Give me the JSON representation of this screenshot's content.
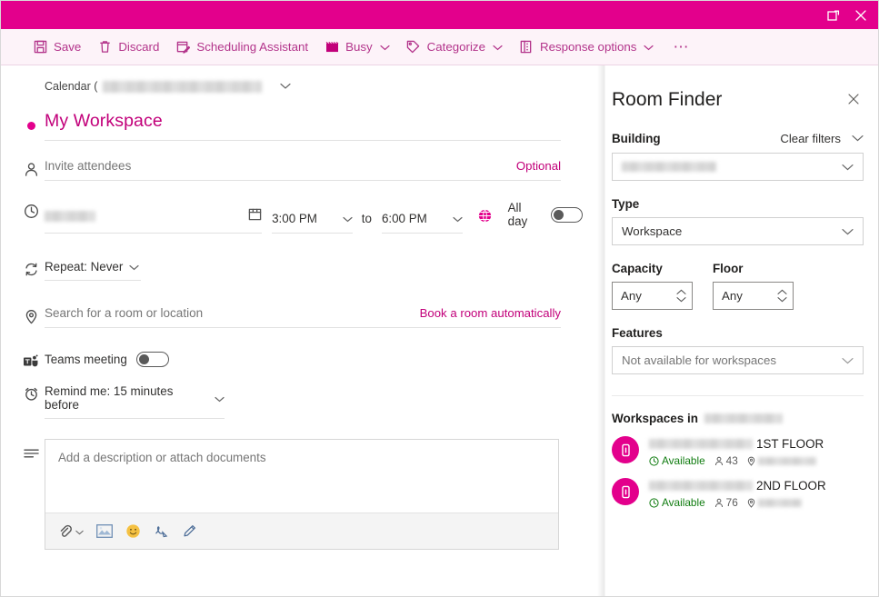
{
  "titlebar": {
    "popout_label": "Open in new window",
    "close_label": "Close",
    "background": "#e3008c"
  },
  "toolbar": {
    "save_label": "Save",
    "discard_label": "Discard",
    "scheduling_assistant_label": "Scheduling Assistant",
    "busy_label": "Busy",
    "categorize_label": "Categorize",
    "response_options_label": "Response options",
    "overflow_label": "⋯",
    "accent": "#b3348b"
  },
  "form": {
    "calendar_prefix": "Calendar (",
    "calendar_value_redacted": true,
    "event_title": "My Workspace",
    "attendees_placeholder": "Invite attendees",
    "optional_label": "Optional",
    "date_value_redacted": true,
    "start_time": "3:00 PM",
    "to_label": "to",
    "end_time": "6:00 PM",
    "all_day_label": "All day",
    "all_day_on": false,
    "repeat_label": "Repeat: Never",
    "location_placeholder": "Search for a room or location",
    "book_room_label": "Book a room automatically",
    "teams_meeting_label": "Teams meeting",
    "teams_meeting_on": false,
    "remind_label": "Remind me: 15 minutes before",
    "description_placeholder": "Add a description or attach documents",
    "description_toolbar": [
      {
        "name": "attach-icon",
        "label": "Attach file"
      },
      {
        "name": "image-icon",
        "label": "Insert picture"
      },
      {
        "name": "emoji-icon",
        "label": "Insert emoji"
      },
      {
        "name": "signature-icon",
        "label": "Signature"
      },
      {
        "name": "ink-icon",
        "label": "Ink"
      }
    ]
  },
  "panel": {
    "title": "Room Finder",
    "close_label": "Close",
    "building_label": "Building",
    "clear_filters_label": "Clear filters",
    "building_value_redacted": true,
    "type_label": "Type",
    "type_value": "Workspace",
    "capacity_label": "Capacity",
    "capacity_value": "Any",
    "floor_label": "Floor",
    "floor_value": "Any",
    "features_label": "Features",
    "features_value": "Not available for workspaces",
    "workspaces_heading": "Workspaces in",
    "workspaces_heading_value_redacted": true,
    "workspaces": [
      {
        "name_suffix": "1ST FLOOR",
        "name_redacted": true,
        "status": "Available",
        "capacity": "43",
        "location_redacted": true
      },
      {
        "name_suffix": "2ND FLOOR",
        "name_redacted": true,
        "status": "Available",
        "capacity": "76",
        "location_redacted": true
      }
    ],
    "status_color": "#107c10",
    "avatar_color": "#e3008c"
  }
}
